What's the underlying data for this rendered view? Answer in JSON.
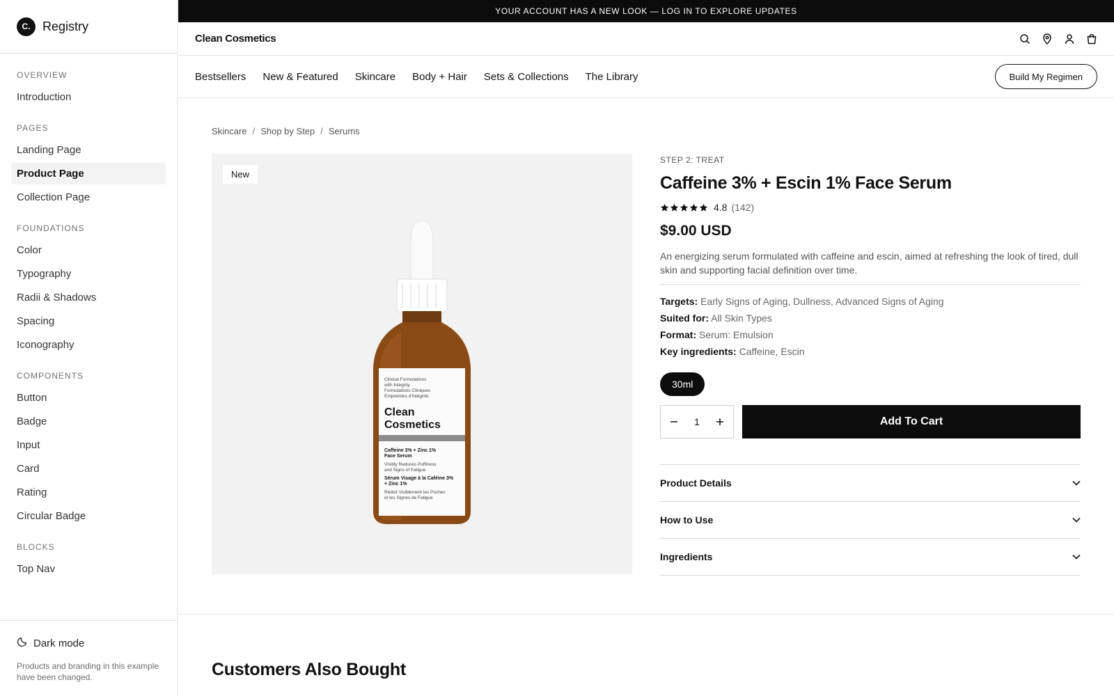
{
  "sidebar": {
    "brand_initial": "C.",
    "brand_name": "Registry",
    "sections": [
      {
        "heading": "OVERVIEW",
        "items": [
          "Introduction"
        ]
      },
      {
        "heading": "PAGES",
        "items": [
          "Landing Page",
          "Product Page",
          "Collection Page"
        ]
      },
      {
        "heading": "FOUNDATIONS",
        "items": [
          "Color",
          "Typography",
          "Radii & Shadows",
          "Spacing",
          "Iconography"
        ]
      },
      {
        "heading": "COMPONENTS",
        "items": [
          "Button",
          "Badge",
          "Input",
          "Card",
          "Rating",
          "Circular Badge"
        ]
      },
      {
        "heading": "BLOCKS",
        "items": [
          "Top Nav"
        ]
      }
    ],
    "active_item": "Product Page",
    "dark_mode_label": "Dark mode",
    "footer_note": "Products and branding in this example have been changed."
  },
  "announcement": "YOUR ACCOUNT HAS A NEW LOOK — LOG IN TO EXPLORE UPDATES",
  "header": {
    "store_name": "Clean Cosmetics",
    "icons": [
      "search-icon",
      "location-icon",
      "account-icon",
      "cart-icon"
    ]
  },
  "nav": {
    "links": [
      "Bestsellers",
      "New & Featured",
      "Skincare",
      "Body + Hair",
      "Sets & Collections",
      "The Library"
    ],
    "cta": "Build My Regimen"
  },
  "breadcrumb": [
    "Skincare",
    "Shop by Step",
    "Serums"
  ],
  "breadcrumb_separator": "/",
  "product": {
    "badge": "New",
    "label": {
      "tagline": "Clinical Formulations with Integrity. Formulations Cliniques Empreintes d'Intégrité.",
      "brand_line1": "Clean",
      "brand_line2": "Cosmetics",
      "name_en": "Caffeine 3% + Zinc 1% Face Serum",
      "claim_en": "Visibly Reduces Puffiness and Signs of Fatigue",
      "name_fr": "Sérum Visage à la Caféine 3% + Zinc 1%",
      "claim_fr": "Réduit Visiblement les Poches et les Signes de Fatigue"
    },
    "step": "STEP 2: TREAT",
    "title": "Caffeine 3% + Escin 1% Face Serum",
    "rating": {
      "stars": 5,
      "score": "4.8",
      "count": "(142)"
    },
    "price": "$9.00 USD",
    "description": "An energizing serum formulated with caffeine and escin, aimed at refreshing the look of tired, dull skin and supporting facial definition over time.",
    "attributes": [
      {
        "label": "Targets:",
        "value": "Early Signs of Aging, Dullness, Advanced Signs of Aging"
      },
      {
        "label": "Suited for:",
        "value": "All Skin Types"
      },
      {
        "label": "Format:",
        "value": "Serum: Emulsion"
      },
      {
        "label": "Key ingredients:",
        "value": "Caffeine, Escin"
      }
    ],
    "size": "30ml",
    "quantity": "1",
    "add_to_cart": "Add To Cart",
    "accordions": [
      "Product Details",
      "How to Use",
      "Ingredients"
    ]
  },
  "related": {
    "title": "Customers Also Bought"
  },
  "colors": {
    "primary": "#0c0c0c",
    "border": "#e3e3e3",
    "muted_text": "#555555",
    "image_bg": "#f2f2f2",
    "bottle_amber": "#8a4a16"
  }
}
